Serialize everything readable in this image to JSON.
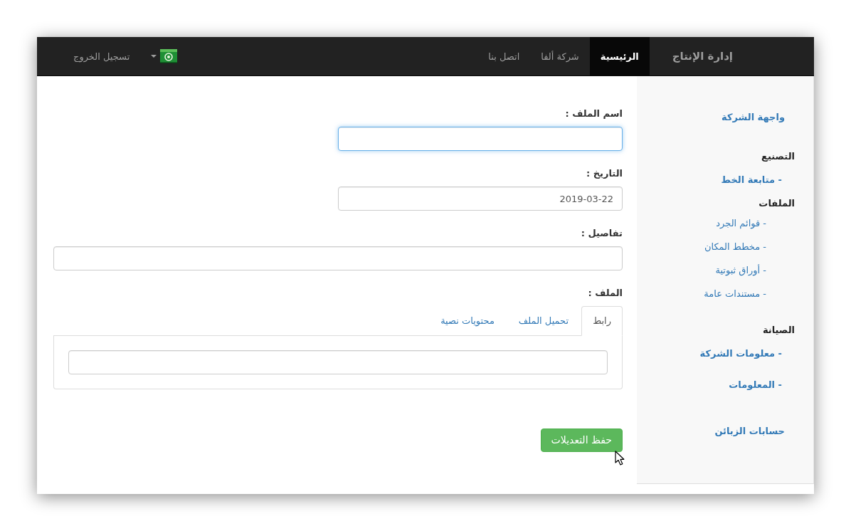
{
  "navbar": {
    "brand": "إدارة الإنتاج",
    "items": [
      {
        "label": "الرئيسية",
        "selected": true
      },
      {
        "label": "شركة ألفا",
        "selected": false
      },
      {
        "label": "اتصل بنا",
        "selected": false
      }
    ],
    "logout": "تسجيل الخروج"
  },
  "sidebar": {
    "items": [
      {
        "kind": "link",
        "label": "واجهة الشركة"
      },
      {
        "kind": "section",
        "label": "التصنيع",
        "children": [
          {
            "kind": "main",
            "label": "- متابعة الخط"
          }
        ]
      },
      {
        "kind": "section",
        "label": "الملفات",
        "children": [
          {
            "kind": "sub",
            "label": "- قوائم الجرد"
          },
          {
            "kind": "sub",
            "label": "- مخطط المكان"
          },
          {
            "kind": "sub",
            "label": "- أوراق ثبوتية"
          },
          {
            "kind": "sub",
            "label": "- مستندات عامة"
          }
        ]
      },
      {
        "kind": "section",
        "label": "الصيانة",
        "children": [
          {
            "kind": "main",
            "label": "- معلومات الشركة"
          },
          {
            "kind": "main",
            "label": "- المعلومات"
          }
        ]
      },
      {
        "kind": "link",
        "label": "حسابات الزبائن"
      }
    ]
  },
  "form": {
    "fields": [
      {
        "kind": "half",
        "label": "اسم الملف :",
        "focused": true
      },
      {
        "kind": "half",
        "label": "التاريخ :",
        "value": "2019-03-22",
        "focused": false
      },
      {
        "kind": "full",
        "label": "تفاصيل :",
        "focused": false
      }
    ],
    "file": {
      "label": "الملف :",
      "tabs": [
        {
          "label": "رابط",
          "selected": true
        },
        {
          "label": "تحميل الملف",
          "selected": false
        },
        {
          "label": "محتويات نصية",
          "selected": false
        }
      ]
    },
    "save_button": "حفظ التعديلات"
  }
}
